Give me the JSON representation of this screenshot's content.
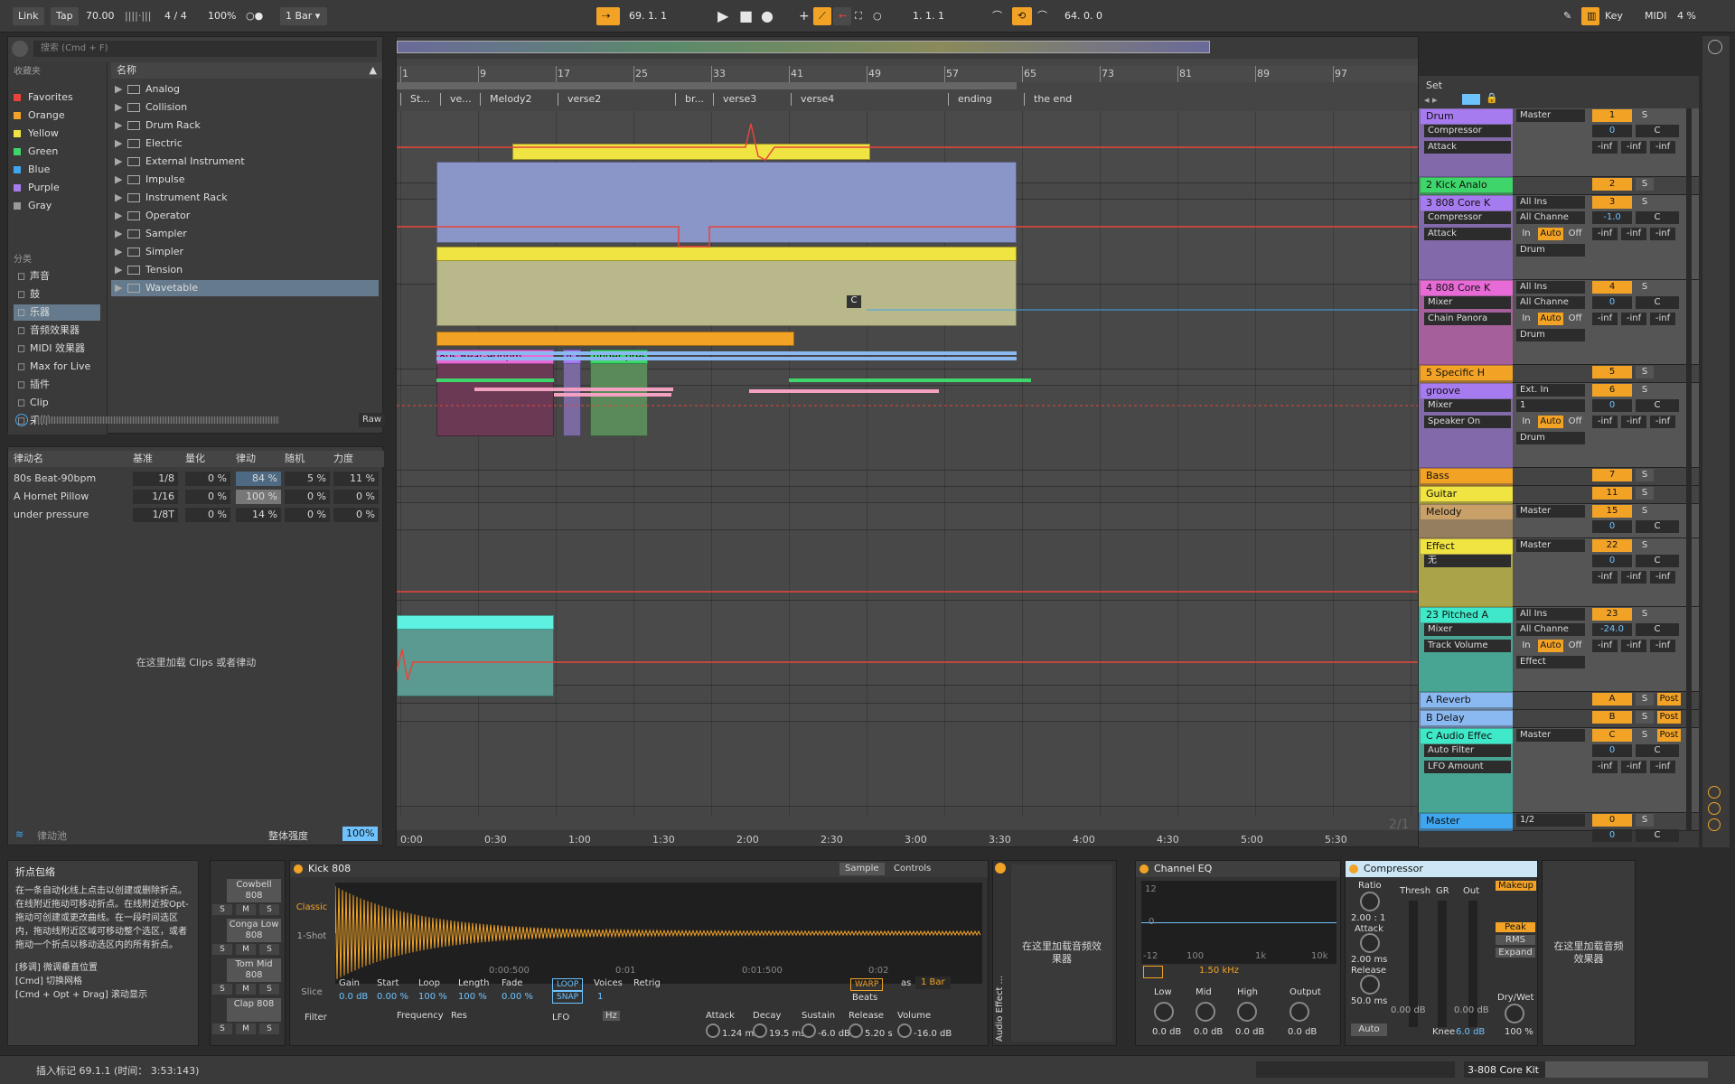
{
  "topbar": {
    "link": "Link",
    "tap": "Tap",
    "tempo": "70.00",
    "signature": "4 / 4",
    "zoom": "100%",
    "quantize": "1 Bar",
    "position": "69.  1.  1",
    "loop_start": "1.  1.  1",
    "loop_length": "64.  0.  0",
    "key": "Key",
    "midi": "MIDI",
    "cpu": "4 %"
  },
  "browser": {
    "search_placeholder": "搜索 (Cmd + F)",
    "collections_header": "收藏夹",
    "collections": [
      {
        "label": "Favorites",
        "color": "#e8443a"
      },
      {
        "label": "Orange",
        "color": "#f2a326"
      },
      {
        "label": "Yellow",
        "color": "#f0e442"
      },
      {
        "label": "Green",
        "color": "#3ed66a"
      },
      {
        "label": "Blue",
        "color": "#3fa6f0"
      },
      {
        "label": "Purple",
        "color": "#a77bf0"
      },
      {
        "label": "Gray",
        "color": "#9a9a9a"
      }
    ],
    "categories_header": "分类",
    "categories": [
      "声音",
      "鼓",
      "乐器",
      "音频效果器",
      "MIDI 效果器",
      "Max for Live",
      "插件",
      "Clip",
      "采样"
    ],
    "name_header": "名称",
    "files": [
      "Analog",
      "Collision",
      "Drum Rack",
      "Electric",
      "External Instrument",
      "Impulse",
      "Instrument Rack",
      "Operator",
      "Sampler",
      "Simpler",
      "Tension",
      "Wavetable"
    ],
    "raw": "Raw"
  },
  "groove": {
    "headers": [
      "律动名",
      "基准",
      "量化",
      "律动",
      "随机",
      "力度"
    ],
    "rows": [
      {
        "name": "80s Beat-90bpm",
        "base": "1/8",
        "quant": "0 %",
        "timing": "84 %",
        "random": "5 %",
        "velocity": "11 %"
      },
      {
        "name": "A Hornet Pillow",
        "base": "1/16",
        "quant": "0 %",
        "timing": "100 %",
        "random": "0 %",
        "velocity": "0 %"
      },
      {
        "name": "under pressure",
        "base": "1/8T",
        "quant": "0 %",
        "timing": "14 %",
        "random": "0 %",
        "velocity": "0 %"
      }
    ],
    "drop_hint": "在这里加载 Clips 或者律动",
    "pool": "律动池",
    "amount_label": "整体强度",
    "amount": "100%"
  },
  "info": {
    "title": "折点包络",
    "body": "在一条自动化线上点击以创建或删除折点。在线附近拖动可移动折点。在线附近按Opt-拖动可创建或更改曲线。在一段时间选区内，拖动线附近区域可移动整个选区，或者拖动一个折点以移动选区内的所有折点。",
    "tips": [
      "[移调] 微调垂直位置",
      "[Cmd] 切换网格",
      "[Cmd + Opt + Drag] 滚动显示"
    ]
  },
  "arrangement": {
    "bars": [
      "1",
      "9",
      "17",
      "25",
      "33",
      "41",
      "49",
      "57",
      "65",
      "73",
      "81",
      "89",
      "97"
    ],
    "locators": [
      "St...",
      "ve...",
      "Melody2",
      "verse2",
      "br...",
      "verse3",
      "verse4",
      "ending",
      "the end"
    ],
    "times": [
      "0:00",
      "0:30",
      "1:00",
      "1:30",
      "2:00",
      "2:30",
      "3:00",
      "3:30",
      "4:00",
      "4:30",
      "5:00",
      "5:30"
    ],
    "clip_labels": [
      "80s Beat-90bpm",
      "A H",
      "under press"
    ],
    "c_label": "C",
    "page": "2/1",
    "set_label": "Set"
  },
  "mixer": {
    "tracks": [
      {
        "name": "Drum",
        "color": "#a77bf0",
        "io": "Master",
        "num": "1",
        "vol": "0",
        "dev1": "Compressor",
        "dev2": "Attack"
      },
      {
        "name": "2 Kick Analo",
        "color": "#3ed66a",
        "num": "2"
      },
      {
        "name": "3 808 Core K",
        "color": "#a77bf0",
        "io": "All Ins",
        "io2": "All Channe",
        "num": "3",
        "vol": "-1.0",
        "dev1": "Compressor",
        "dev2": "Attack",
        "out": "Drum"
      },
      {
        "name": "4 808 Core K",
        "color": "#e86ad6",
        "io": "All Ins",
        "io2": "All Channe",
        "num": "4",
        "vol": "0",
        "dev1": "Mixer",
        "dev2": "Chain Panora",
        "out": "Drum"
      },
      {
        "name": "5 Specific H",
        "color": "#f2a326",
        "num": "5"
      },
      {
        "name": "groove",
        "color": "#a77bf0",
        "io": "Ext. In",
        "io2": "1",
        "num": "6",
        "vol": "0",
        "dev1": "Mixer",
        "dev2": "Speaker On",
        "out": "Drum"
      },
      {
        "name": "Bass",
        "color": "#f2a326",
        "num": "7"
      },
      {
        "name": "Guitar",
        "color": "#f0e442",
        "num": "11"
      },
      {
        "name": "Melody",
        "color": "#c8a068",
        "io": "Master",
        "num": "15",
        "vol": "0"
      },
      {
        "name": "Effect",
        "color": "#f0e442",
        "io": "Master",
        "num": "22",
        "vol": "0",
        "dev1": "无"
      },
      {
        "name": "23 Pitched A",
        "color": "#3ee8c8",
        "io": "All Ins",
        "io2": "All Channe",
        "num": "23",
        "vol": "-24.0",
        "dev1": "Mixer",
        "dev2": "Track Volume",
        "out": "Effect"
      },
      {
        "name": "A Reverb",
        "color": "#8ab8f0",
        "num": "A",
        "post": "Post"
      },
      {
        "name": "B Delay",
        "color": "#8ab8f0",
        "num": "B",
        "post": "Post"
      },
      {
        "name": "C Audio Effec",
        "color": "#3ee8c8",
        "io": "Master",
        "num": "C",
        "vol": "0",
        "dev1": "Auto Filter",
        "dev2": "LFO Amount",
        "post": "Post"
      },
      {
        "name": "Master",
        "color": "#3fa6f0",
        "io": "1/2",
        "num": "0",
        "vol": "0"
      }
    ],
    "s": "S",
    "c": "C",
    "inf": "-inf",
    "in": "In",
    "auto": "Auto",
    "off": "Off"
  },
  "detail": {
    "drumpads": [
      "Cowbell 808",
      "Conga Low 808",
      "Tom Mid 808",
      "Clap 808"
    ],
    "simpler": {
      "title": "Kick 808",
      "tab1": "Sample",
      "tab2": "Controls",
      "mode": "Classic",
      "oneshot": "1-Shot",
      "slice": "Slice",
      "ruler": [
        "0:00:500",
        "0:01",
        "0:01:500",
        "0:02"
      ],
      "params": [
        {
          "l": "Gain",
          "v": "0.0 dB"
        },
        {
          "l": "Start",
          "v": "0.00 %"
        },
        {
          "l": "Loop",
          "v": "100 %"
        },
        {
          "l": "Length",
          "v": "100 %"
        },
        {
          "l": "Fade",
          "v": "0.00 %"
        }
      ],
      "loop": "LOOP",
      "snap": "SNAP",
      "voices_l": "Voices",
      "voices": "1",
      "retrig": "Retrig",
      "warp": "WARP",
      "as": "as",
      "warp_len": "1 Bar",
      "beats": "Beats",
      "filter": "Filter",
      "freq": "Frequency",
      "res": "Res",
      "lfo": "LFO",
      "hz": "Hz",
      "env": [
        {
          "l": "Attack",
          "v": "1.24 ms"
        },
        {
          "l": "Decay",
          "v": "19.5 ms"
        },
        {
          "l": "Sustain",
          "v": "-6.0 dB"
        },
        {
          "l": "Release",
          "v": "5.20 s"
        },
        {
          "l": "Volume",
          "v": "-16.0 dB"
        }
      ]
    },
    "audio_effect_rack": "Audio Effect ...",
    "drop_audio": "在这里加载音频效果器",
    "eq": {
      "title": "Channel EQ",
      "db_top": "12",
      "db_mid": "0",
      "db_bot": "-12",
      "f1": "100",
      "f2": "1k",
      "f3": "10k",
      "freq": "1.50 kHz",
      "bands": [
        {
          "l": "Low",
          "v": "0.0 dB"
        },
        {
          "l": "Mid",
          "v": "0.0 dB"
        },
        {
          "l": "High",
          "v": "0.0 dB"
        },
        {
          "l": "Output",
          "v": "0.0 dB"
        }
      ]
    },
    "comp": {
      "title": "Compressor",
      "ratio_l": "Ratio",
      "ratio": "2.00 : 1",
      "attack_l": "Attack",
      "attack": "2.00 ms",
      "release_l": "Release",
      "release": "50.0 ms",
      "auto": "Auto",
      "thresh": "Thresh",
      "gr": "GR",
      "out": "Out",
      "thresh_v": "0.00 dB",
      "out_v": "0.00 dB",
      "makeup": "Makeup",
      "peak": "Peak",
      "rms": "RMS",
      "expand": "Expand",
      "knee_l": "Knee",
      "knee": "6.0 dB",
      "drywet_l": "Dry/Wet",
      "drywet": "100 %"
    }
  },
  "status": {
    "message": "插入标记 69.1.1 (时间： 3:53:143)",
    "track": "3-808 Core Kit"
  }
}
